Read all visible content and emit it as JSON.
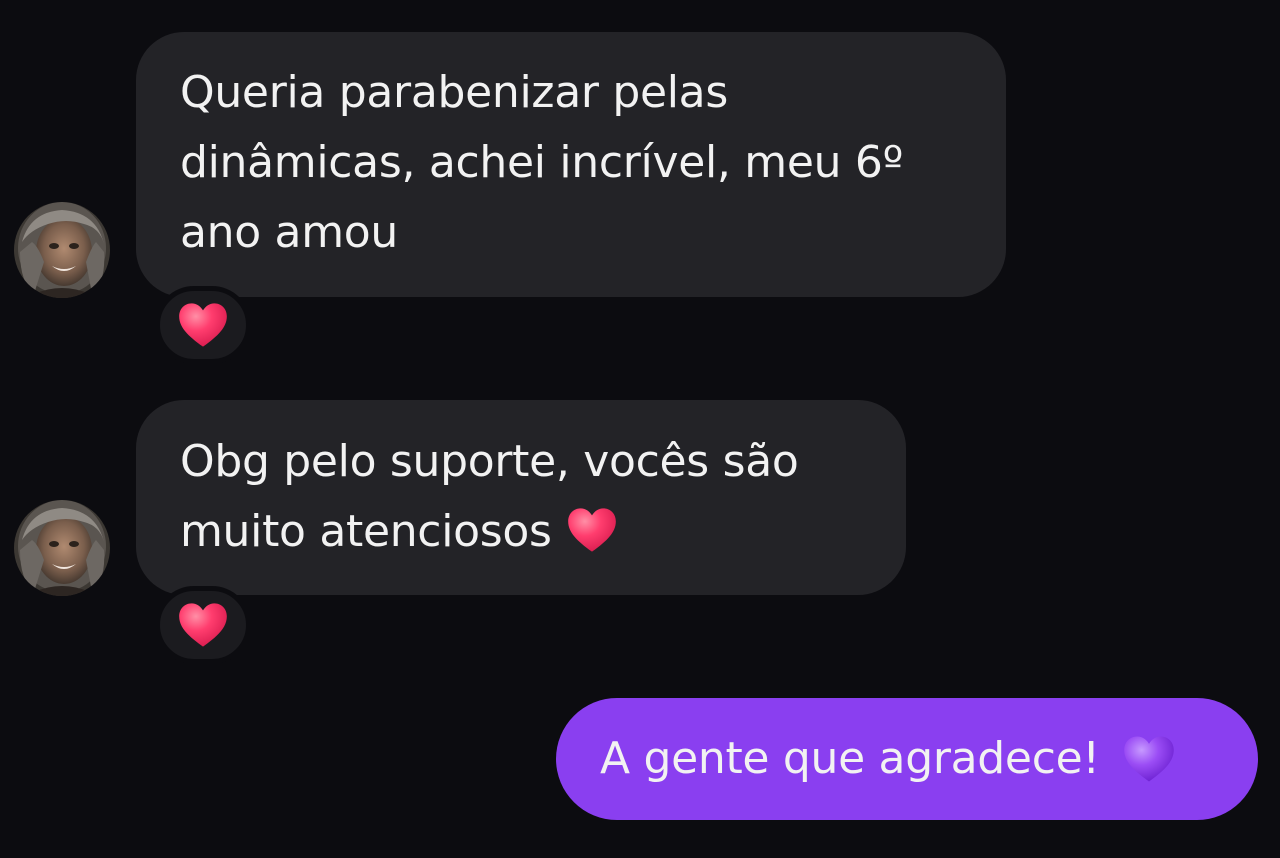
{
  "conversation": {
    "messages": [
      {
        "direction": "incoming",
        "text": "Queria parabenizar pelas dinâmicas, achei incrível, meu 6º ano amou",
        "reaction_icon": "red-heart-icon"
      },
      {
        "direction": "incoming",
        "text": "Obg pelo suporte, vocês são muito atenciosos",
        "inline_emoji": "red-heart-icon",
        "reaction_icon": "red-heart-icon"
      },
      {
        "direction": "outgoing",
        "text": "A gente que agradece!",
        "inline_emoji": "purple-heart-icon"
      }
    ]
  },
  "colors": {
    "background": "#0c0c10",
    "incoming_bubble": "#232327",
    "outgoing_bubble": "#8a3ff0",
    "text": "#f2f2f2",
    "red_heart": "#ff3d6e",
    "purple_heart": "#9b4df5"
  }
}
